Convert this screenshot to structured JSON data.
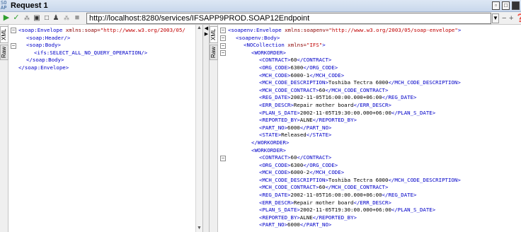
{
  "window": {
    "title": "Request 1",
    "app_icon_text": "SO\nAP"
  },
  "toolbar": {
    "url": "http://localhost:8280/services/IFSAPP9PROD.SOAP12Endpoint",
    "icons": [
      "run-icon",
      "add-assertion-icon",
      "wsdl-icon",
      "format-icon",
      "stop-icon",
      "user-icon",
      "wss-icon",
      "tile-icon"
    ],
    "right_icons": [
      "minus-icon",
      "plus-icon",
      "help-icon"
    ]
  },
  "left_pane": {
    "tabs": [
      "XML",
      "Raw"
    ],
    "lines": [
      {
        "indent": 0,
        "parts": [
          {
            "c": "tag",
            "t": "<soap:Envelope "
          },
          {
            "c": "attr",
            "t": "xmlns:soap="
          },
          {
            "c": "val",
            "t": "\"http://www.w3.org/2003/05/"
          }
        ]
      },
      {
        "indent": 1,
        "parts": [
          {
            "c": "tag",
            "t": "<soap:Header/>"
          }
        ]
      },
      {
        "indent": 1,
        "parts": [
          {
            "c": "tag",
            "t": "<soap:Body>"
          }
        ]
      },
      {
        "indent": 2,
        "parts": [
          {
            "c": "tag",
            "t": "<ifs:SELECT_ALL_NO_QUERY_OPERATION/>"
          }
        ]
      },
      {
        "indent": 1,
        "parts": [
          {
            "c": "tag",
            "t": "</soap:Body>"
          }
        ]
      },
      {
        "indent": 0,
        "parts": [
          {
            "c": "tag",
            "t": "</soap:Envelope>"
          }
        ]
      }
    ]
  },
  "right_pane": {
    "tabs": [
      "XML",
      "Raw"
    ],
    "lines": [
      {
        "indent": 0,
        "parts": [
          {
            "c": "tag",
            "t": "<soapenv:Envelope "
          },
          {
            "c": "attr",
            "t": "xmlns:soapenv="
          },
          {
            "c": "val",
            "t": "\"http://www.w3.org/2003/05/soap-envelope\""
          },
          {
            "c": "tag",
            "t": ">"
          }
        ]
      },
      {
        "indent": 1,
        "parts": [
          {
            "c": "tag",
            "t": "<soapenv:Body>"
          }
        ]
      },
      {
        "indent": 2,
        "parts": [
          {
            "c": "tag",
            "t": "<NOCollection "
          },
          {
            "c": "attr",
            "t": "xmlns="
          },
          {
            "c": "val",
            "t": "\"IFS\""
          },
          {
            "c": "tag",
            "t": ">"
          }
        ]
      },
      {
        "indent": 3,
        "parts": [
          {
            "c": "tag",
            "t": "<WORKORDER>"
          }
        ]
      },
      {
        "indent": 4,
        "parts": [
          {
            "c": "tag",
            "t": "<CONTRACT>"
          },
          {
            "c": "txt",
            "t": "60"
          },
          {
            "c": "tag",
            "t": "</CONTRACT>"
          }
        ]
      },
      {
        "indent": 4,
        "parts": [
          {
            "c": "tag",
            "t": "<ORG_CODE>"
          },
          {
            "c": "txt",
            "t": "6300"
          },
          {
            "c": "tag",
            "t": "</ORG_CODE>"
          }
        ]
      },
      {
        "indent": 4,
        "parts": [
          {
            "c": "tag",
            "t": "<MCH_CODE>"
          },
          {
            "c": "txt",
            "t": "6000-1"
          },
          {
            "c": "tag",
            "t": "</MCH_CODE>"
          }
        ]
      },
      {
        "indent": 4,
        "parts": [
          {
            "c": "tag",
            "t": "<MCH_CODE_DESCRIPTION>"
          },
          {
            "c": "txt",
            "t": "Toshiba Tectra 6000"
          },
          {
            "c": "tag",
            "t": "</MCH_CODE_DESCRIPTION>"
          }
        ]
      },
      {
        "indent": 4,
        "parts": [
          {
            "c": "tag",
            "t": "<MCH_CODE_CONTRACT>"
          },
          {
            "c": "txt",
            "t": "60"
          },
          {
            "c": "tag",
            "t": "</MCH_CODE_CONTRACT>"
          }
        ]
      },
      {
        "indent": 4,
        "parts": [
          {
            "c": "tag",
            "t": "<REG_DATE>"
          },
          {
            "c": "txt",
            "t": "2002-11-05T16:00:00.000+06:00"
          },
          {
            "c": "tag",
            "t": "</REG_DATE>"
          }
        ]
      },
      {
        "indent": 4,
        "parts": [
          {
            "c": "tag",
            "t": "<ERR_DESCR>"
          },
          {
            "c": "txt",
            "t": "Repair mother board"
          },
          {
            "c": "tag",
            "t": "</ERR_DESCR>"
          }
        ]
      },
      {
        "indent": 4,
        "parts": [
          {
            "c": "tag",
            "t": "<PLAN_S_DATE>"
          },
          {
            "c": "txt",
            "t": "2002-11-05T19:30:00.000+06:00"
          },
          {
            "c": "tag",
            "t": "</PLAN_S_DATE>"
          }
        ]
      },
      {
        "indent": 4,
        "parts": [
          {
            "c": "tag",
            "t": "<REPORTED_BY>"
          },
          {
            "c": "txt",
            "t": "ALNE"
          },
          {
            "c": "tag",
            "t": "</REPORTED_BY>"
          }
        ]
      },
      {
        "indent": 4,
        "parts": [
          {
            "c": "tag",
            "t": "<PART_NO>"
          },
          {
            "c": "txt",
            "t": "6000"
          },
          {
            "c": "tag",
            "t": "</PART_NO>"
          }
        ]
      },
      {
        "indent": 4,
        "parts": [
          {
            "c": "tag",
            "t": "<STATE>"
          },
          {
            "c": "txt",
            "t": "Released"
          },
          {
            "c": "tag",
            "t": "</STATE>"
          }
        ]
      },
      {
        "indent": 3,
        "parts": [
          {
            "c": "tag",
            "t": "</WORKORDER>"
          }
        ]
      },
      {
        "indent": 3,
        "parts": [
          {
            "c": "tag",
            "t": "<WORKORDER>"
          }
        ]
      },
      {
        "indent": 4,
        "parts": [
          {
            "c": "tag",
            "t": "<CONTRACT>"
          },
          {
            "c": "txt",
            "t": "60"
          },
          {
            "c": "tag",
            "t": "</CONTRACT>"
          }
        ]
      },
      {
        "indent": 4,
        "parts": [
          {
            "c": "tag",
            "t": "<ORG_CODE>"
          },
          {
            "c": "txt",
            "t": "6300"
          },
          {
            "c": "tag",
            "t": "</ORG_CODE>"
          }
        ]
      },
      {
        "indent": 4,
        "parts": [
          {
            "c": "tag",
            "t": "<MCH_CODE>"
          },
          {
            "c": "txt",
            "t": "6000-2"
          },
          {
            "c": "tag",
            "t": "</MCH_CODE>"
          }
        ]
      },
      {
        "indent": 4,
        "parts": [
          {
            "c": "tag",
            "t": "<MCH_CODE_DESCRIPTION>"
          },
          {
            "c": "txt",
            "t": "Toshiba Tectra 6000"
          },
          {
            "c": "tag",
            "t": "</MCH_CODE_DESCRIPTION>"
          }
        ]
      },
      {
        "indent": 4,
        "parts": [
          {
            "c": "tag",
            "t": "<MCH_CODE_CONTRACT>"
          },
          {
            "c": "txt",
            "t": "60"
          },
          {
            "c": "tag",
            "t": "</MCH_CODE_CONTRACT>"
          }
        ]
      },
      {
        "indent": 4,
        "parts": [
          {
            "c": "tag",
            "t": "<REG_DATE>"
          },
          {
            "c": "txt",
            "t": "2002-11-05T16:00:00.000+06:00"
          },
          {
            "c": "tag",
            "t": "</REG_DATE>"
          }
        ]
      },
      {
        "indent": 4,
        "parts": [
          {
            "c": "tag",
            "t": "<ERR_DESCR>"
          },
          {
            "c": "txt",
            "t": "Repair mother board"
          },
          {
            "c": "tag",
            "t": "</ERR_DESCR>"
          }
        ]
      },
      {
        "indent": 4,
        "parts": [
          {
            "c": "tag",
            "t": "<PLAN_S_DATE>"
          },
          {
            "c": "txt",
            "t": "2002-11-05T19:30:00.000+06:00"
          },
          {
            "c": "tag",
            "t": "</PLAN_S_DATE>"
          }
        ]
      },
      {
        "indent": 4,
        "parts": [
          {
            "c": "tag",
            "t": "<REPORTED_BY>"
          },
          {
            "c": "txt",
            "t": "ALNE"
          },
          {
            "c": "tag",
            "t": "</REPORTED_BY>"
          }
        ]
      },
      {
        "indent": 4,
        "parts": [
          {
            "c": "tag",
            "t": "<PART_NO>"
          },
          {
            "c": "txt",
            "t": "6000"
          },
          {
            "c": "tag",
            "t": "</PART_NO>"
          }
        ]
      }
    ]
  },
  "colors": {
    "tag": "#0000c8",
    "attr": "#8b0000",
    "value": "#c00000",
    "text": "#000000",
    "run_green": "#2e9e2e"
  }
}
